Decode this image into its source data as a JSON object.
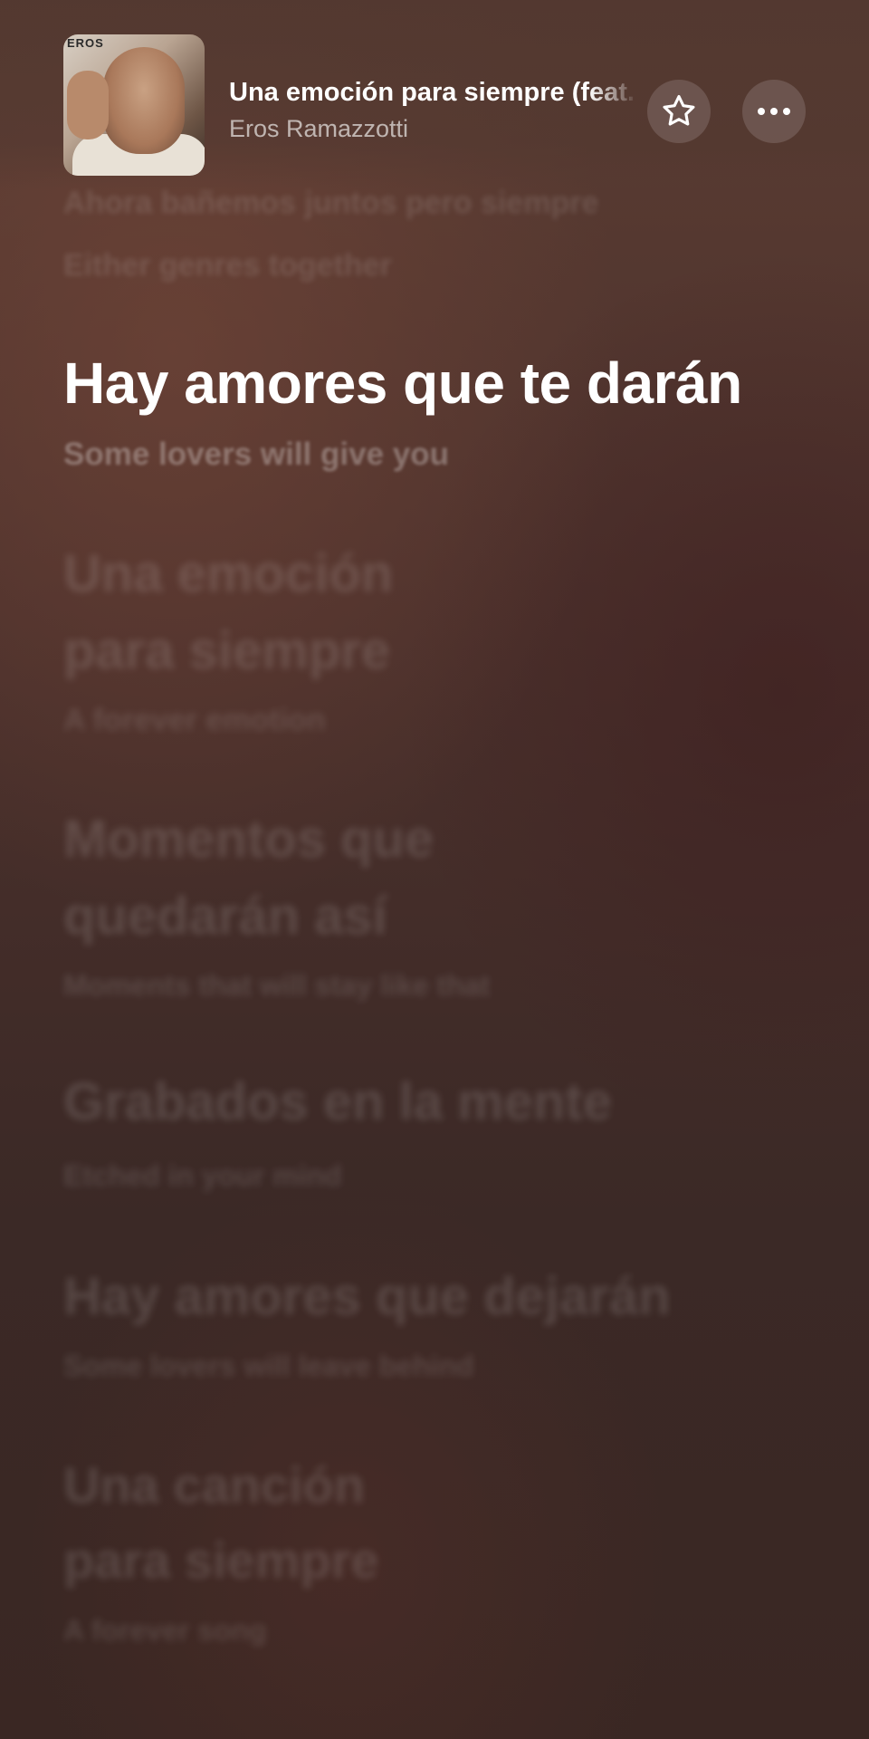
{
  "now_playing": {
    "title": "Una emoción para siempre (feat. Tina Turner)",
    "artist": "Eros Ramazzotti",
    "artwork_brand": "EROS"
  },
  "controls": {
    "favorite_icon": "star-icon",
    "more_icon": "ellipsis-icon"
  },
  "lyrics": {
    "previous": [
      {
        "original": "Ahora bañemos juntos pero siempre",
        "translation": "Either genres together"
      }
    ],
    "current": {
      "original": "Hay amores que te darán",
      "translation": "Some lovers will give you"
    },
    "upcoming": [
      {
        "line1": "Una emoción",
        "line2": "para siempre",
        "translation": "A forever emotion"
      },
      {
        "line1": "Momentos que",
        "line2": "quedarán así",
        "translation": "Moments that will stay like that"
      },
      {
        "line1": "Grabados en la mente",
        "translation": "Etched in your mind"
      },
      {
        "line1": "Hay amores que dejarán",
        "translation": "Some lovers will leave behind"
      },
      {
        "line1": "Una canción",
        "line2": "para siempre",
        "translation": "A forever song"
      }
    ]
  },
  "colors": {
    "background_top": "#5b3d33",
    "background_bottom": "#3a2723",
    "active_text": "#ffffff"
  }
}
